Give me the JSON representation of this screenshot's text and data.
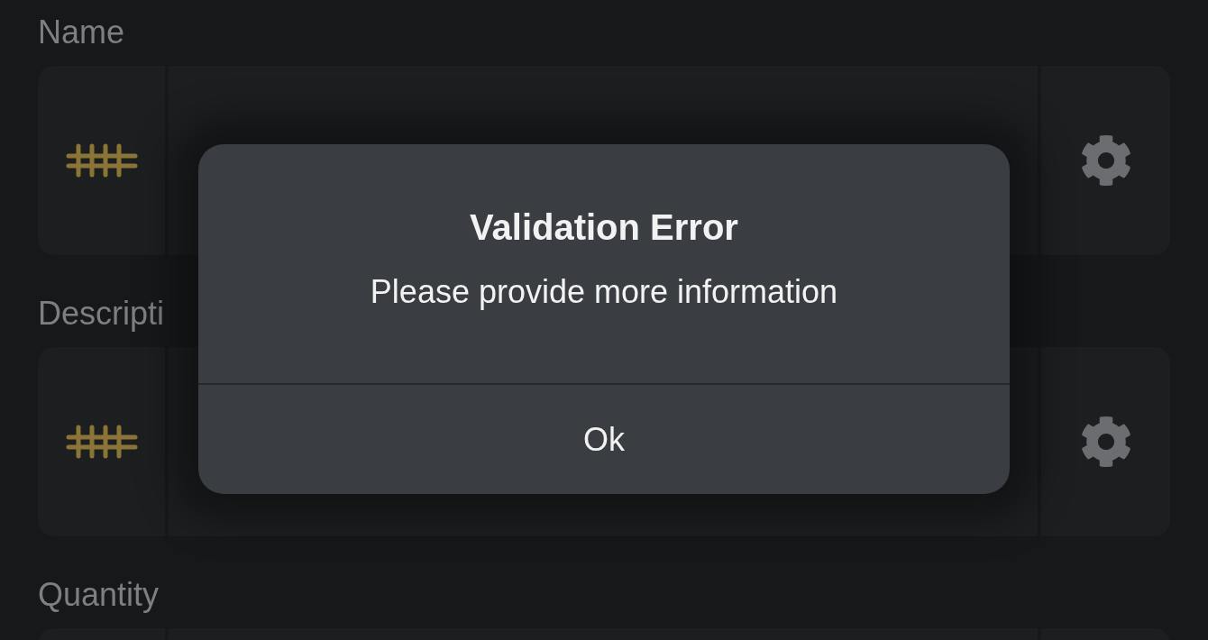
{
  "fields": [
    {
      "label": "Name"
    },
    {
      "label": "Descripti"
    },
    {
      "label": "Quantity"
    }
  ],
  "dialog": {
    "title": "Validation Error",
    "message": "Please provide more information",
    "button": "Ok"
  }
}
